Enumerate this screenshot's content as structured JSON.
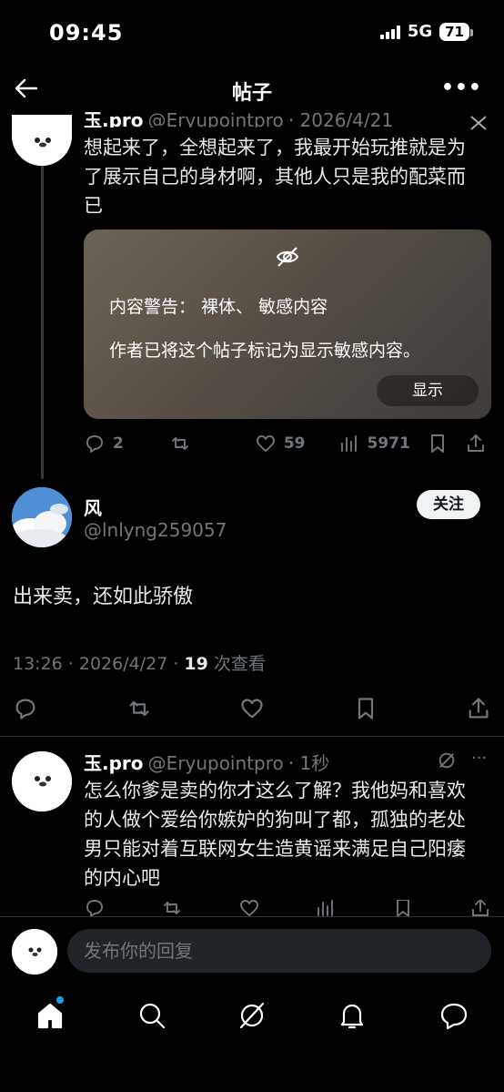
{
  "status": {
    "time": "09:45",
    "network": "5G",
    "battery": "71"
  },
  "header": {
    "title": "帖子"
  },
  "thread": {
    "parent": {
      "name": "玉.pro",
      "handle": "@Eryupointpro",
      "date": "· 2026/4/21",
      "text": "想起来了，全想起来了，我最开始玩推就是为了展示自己的身材啊，其他人只是我的配菜而已",
      "warning": {
        "title": "内容警告： 裸体、 敏感内容",
        "desc": "作者已将这个帖子标记为显示敏感内容。",
        "button": "显示"
      },
      "stats": {
        "replies": "2",
        "likes": "59",
        "views": "5971"
      }
    },
    "main": {
      "name": "风",
      "handle": "@lnlyng259057",
      "follow_label": "关注",
      "text": "出来卖，还如此骄傲",
      "timestamp": "13:26 · 2026/4/27 ·",
      "view_count": "19",
      "view_label": "次查看"
    },
    "reply": {
      "name": "玉.pro",
      "handle": "@Eryupointpro",
      "time": "· 1秒",
      "text": "怎么你爹是卖的你才这么了解？我他妈和喜欢的人做个爱给你嫉妒的狗叫了都，孤独的老处男只能对着互联网女生造黄谣来满足自己阳痿的内心吧"
    }
  },
  "composer": {
    "placeholder": "发布你的回复"
  },
  "tabs": [
    "home",
    "search",
    "grok",
    "notifications",
    "messages"
  ],
  "colors": {
    "accent": "#1d9bf0",
    "background": "#000000",
    "muted": "#71767b"
  }
}
